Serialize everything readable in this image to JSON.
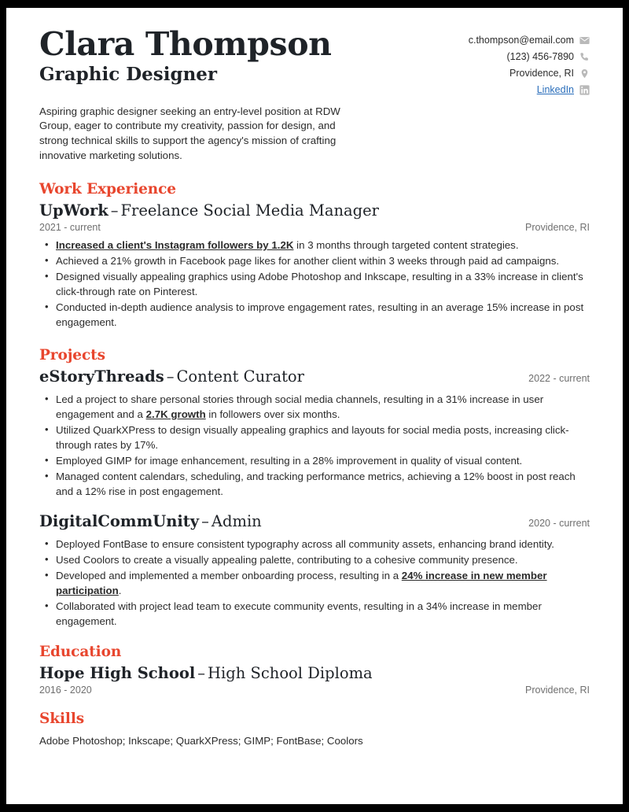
{
  "header": {
    "name": "Clara Thompson",
    "job_title": "Graphic Designer",
    "contact": [
      {
        "icon": "envelope-icon",
        "text": "c.thompson@email.com",
        "is_link": false
      },
      {
        "icon": "phone-icon",
        "text": "(123) 456-7890",
        "is_link": false
      },
      {
        "icon": "location-pin-icon",
        "text": "Providence, RI",
        "is_link": false
      },
      {
        "icon": "linkedin-icon",
        "text": "LinkedIn",
        "is_link": true
      }
    ]
  },
  "summary": "Aspiring graphic designer seeking an entry-level position at RDW Group, eager to contribute my creativity, passion for design, and strong technical skills to support the agency's mission of crafting innovative marketing solutions.",
  "sections": {
    "work_experience": {
      "title": "Work Experience",
      "entries": [
        {
          "org": "UpWork",
          "dash": "–",
          "role": "Freelance Social Media Manager",
          "date": "2021 - current",
          "location": "Providence, RI",
          "date_position": "below",
          "bullets": [
            [
              {
                "text": "Increased a client's Instagram followers by 1.2K",
                "strong": true
              },
              {
                "text": " in 3 months through targeted content strategies.",
                "strong": false
              }
            ],
            [
              {
                "text": "Achieved a 21% growth in Facebook page likes for another client within 3 weeks through paid ad campaigns.",
                "strong": false
              }
            ],
            [
              {
                "text": "Designed visually appealing graphics using Adobe Photoshop and Inkscape, resulting in a 33% increase in client's click-through rate on Pinterest.",
                "strong": false
              }
            ],
            [
              {
                "text": "Conducted in-depth audience analysis to improve engagement rates, resulting in an average 15% increase in post engagement.",
                "strong": false
              }
            ]
          ]
        }
      ]
    },
    "projects": {
      "title": "Projects",
      "entries": [
        {
          "org": "eStoryThreads",
          "dash": "–",
          "role": "Content Curator",
          "date": "2022 - current",
          "location": "",
          "date_position": "right",
          "bullets": [
            [
              {
                "text": "Led a project to share personal stories through social media channels, resulting in a 31% increase in user engagement and a ",
                "strong": false
              },
              {
                "text": "2.7K growth",
                "strong": true
              },
              {
                "text": " in followers over six months.",
                "strong": false
              }
            ],
            [
              {
                "text": "Utilized QuarkXPress to design visually appealing graphics and layouts for social media posts, increasing click-through rates by 17%.",
                "strong": false
              }
            ],
            [
              {
                "text": "Employed GIMP for image enhancement, resulting in a 28% improvement in quality of visual content.",
                "strong": false
              }
            ],
            [
              {
                "text": "Managed content calendars, scheduling, and tracking performance metrics, achieving a 12% boost in post reach and a 12% rise in post engagement.",
                "strong": false
              }
            ]
          ]
        },
        {
          "org": "DigitalCommUnity",
          "dash": "–",
          "role": "Admin",
          "date": "2020 - current",
          "location": "",
          "date_position": "right",
          "bullets": [
            [
              {
                "text": "Deployed FontBase to ensure consistent typography across all community assets, enhancing brand identity.",
                "strong": false
              }
            ],
            [
              {
                "text": "Used Coolors to create a visually appealing palette, contributing to a cohesive community presence.",
                "strong": false
              }
            ],
            [
              {
                "text": "Developed and implemented a member onboarding process, resulting in a ",
                "strong": false
              },
              {
                "text": "24% increase in new member participation",
                "strong": true
              },
              {
                "text": ".",
                "strong": false
              }
            ],
            [
              {
                "text": "Collaborated with project lead team to execute community events, resulting in a 34% increase in member engagement.",
                "strong": false
              }
            ]
          ]
        }
      ]
    },
    "education": {
      "title": "Education",
      "entries": [
        {
          "org": "Hope High School",
          "dash": "–",
          "role": "High School Diploma",
          "date": "2016 - 2020",
          "location": "Providence, RI",
          "date_position": "below",
          "bullets": []
        }
      ]
    },
    "skills": {
      "title": "Skills",
      "text": "Adobe Photoshop; Inkscape; QuarkXPress; GIMP; FontBase; Coolors"
    }
  },
  "colors": {
    "accent": "#e8462e",
    "text": "#2b2b2b",
    "heading": "#1f2328",
    "muted": "#6f6f6f",
    "link": "#2a6ebb",
    "icon": "#b9b9b9",
    "page_border": "#000000"
  }
}
